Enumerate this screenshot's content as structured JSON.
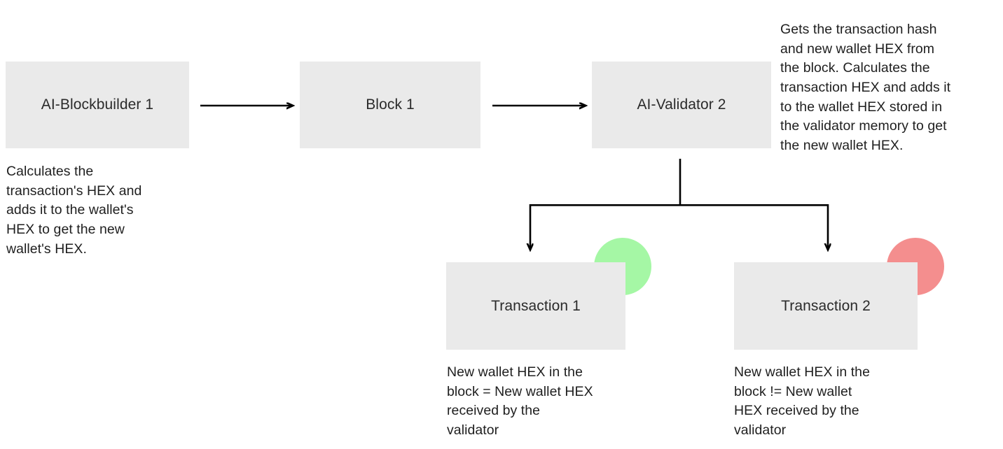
{
  "diagram": {
    "title": "AI-Blockbuilder and AI-Validator transaction verification flow",
    "background_color": "#ffffff",
    "node_fill": "#eaeaea",
    "connector_color": "#000000",
    "nodes": [
      {
        "id": "blockbuilder",
        "label": "AI-Blockbuilder\n1"
      },
      {
        "id": "block",
        "label": "Block 1"
      },
      {
        "id": "validator",
        "label": "AI-Validator\n2"
      },
      {
        "id": "transaction_1",
        "label": "Transaction 1"
      },
      {
        "id": "transaction_2",
        "label": "Transaction 2"
      }
    ],
    "notes": [
      {
        "id": "blockbuilder_note",
        "text": "Calculates the\ntransaction's HEX and\nadds it to the wallet's\nHEX to get the new\nwallet's HEX."
      },
      {
        "id": "validator_note",
        "text": "Gets the transaction hash\nand new wallet HEX from\nthe block. Calculates the\ntransaction HEX and adds it\nto the wallet HEX stored in\nthe validator memory to get\nthe new wallet HEX."
      },
      {
        "id": "transaction_1_note",
        "text": "New wallet HEX in the\nblock = New wallet HEX\nreceived by the\nvalidator"
      },
      {
        "id": "transaction_2_note",
        "text": "New wallet HEX in the\nblock != New wallet\nHEX received by the\nvalidator"
      }
    ],
    "status_indicators": [
      {
        "id": "valid",
        "meaning": "valid",
        "color": "#a5f7a5"
      },
      {
        "id": "invalid",
        "meaning": "invalid",
        "color": "#f48e8e"
      }
    ],
    "connectors": [
      {
        "id": "blockbuilder-to-block",
        "type": "arrow",
        "direction": "right"
      },
      {
        "id": "block-to-validator",
        "type": "arrow",
        "direction": "right"
      },
      {
        "id": "validator-to-transaction-1",
        "type": "elbow-arrow",
        "direction": "down"
      },
      {
        "id": "validator-to-transaction-2",
        "type": "elbow-arrow",
        "direction": "down"
      }
    ]
  }
}
